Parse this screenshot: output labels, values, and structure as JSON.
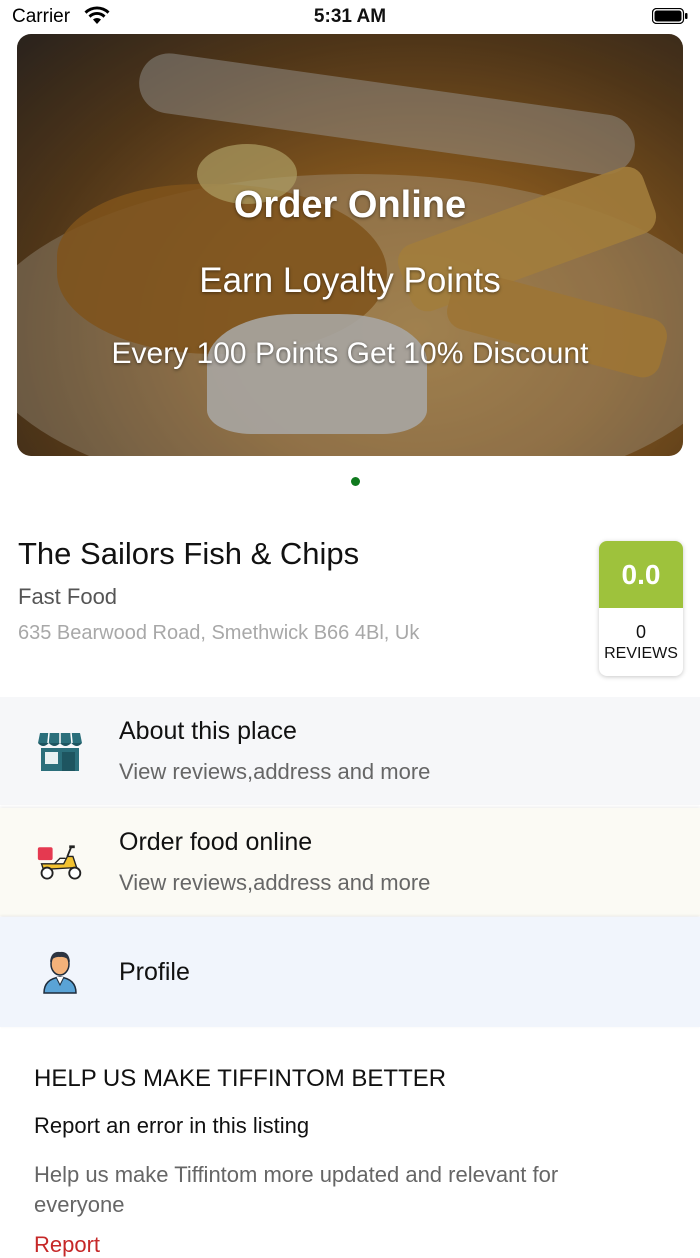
{
  "status": {
    "carrier": "Carrier",
    "time": "5:31 AM"
  },
  "banner": {
    "line1": "Order Online",
    "line2": "Earn Loyalty Points",
    "line3": "Every 100 Points Get 10% Discount"
  },
  "restaurant": {
    "name": "The Sailors Fish & Chips",
    "cuisine": "Fast Food",
    "address": "635 Bearwood Road, Smethwick B66 4Bl, Uk"
  },
  "rating": {
    "score": "0.0",
    "count": "0",
    "label": "REVIEWS",
    "color": "#9ec23c"
  },
  "menu": [
    {
      "title": "About this place",
      "subtitle": "View reviews,address and more",
      "icon": "store-icon"
    },
    {
      "title": "Order food online",
      "subtitle": "View reviews,address and more",
      "icon": "delivery-scooter-icon"
    },
    {
      "title": "Profile",
      "icon": "user-profile-icon"
    }
  ],
  "help": {
    "heading": "HELP US MAKE TIFFINTOM BETTER",
    "link_title": "Report an error in this listing",
    "description": "Help us make Tiffintom more updated and relevant for everyone",
    "report": "Report"
  },
  "colors": {
    "accent_green": "#0f7a1e",
    "report_red": "#c62828"
  }
}
